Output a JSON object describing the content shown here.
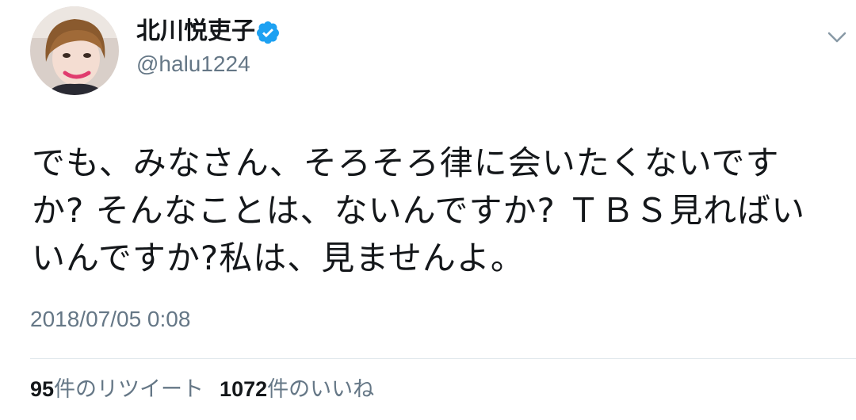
{
  "tweet": {
    "author": {
      "display_name": "北川悦吏子",
      "handle": "@halu1224",
      "verified": true
    },
    "text": "でも、みなさん、そろそろ律に会いたくないです\nか? そんなことは、ないんですか? ＴＢＳ見ればい\nいんですか?私は、見ませんよ。",
    "timestamp": "2018/07/05 0:08",
    "stats": {
      "retweet_count": "95",
      "retweet_label": "件のリツイート",
      "like_count": "1072",
      "like_label": "件のいいね"
    }
  },
  "colors": {
    "text_primary": "#14171a",
    "text_secondary": "#657786",
    "verified_blue": "#1da1f2",
    "divider": "#e1e8ed"
  },
  "icons": {
    "verified": "verified-badge-icon",
    "caret": "chevron-down-icon"
  }
}
